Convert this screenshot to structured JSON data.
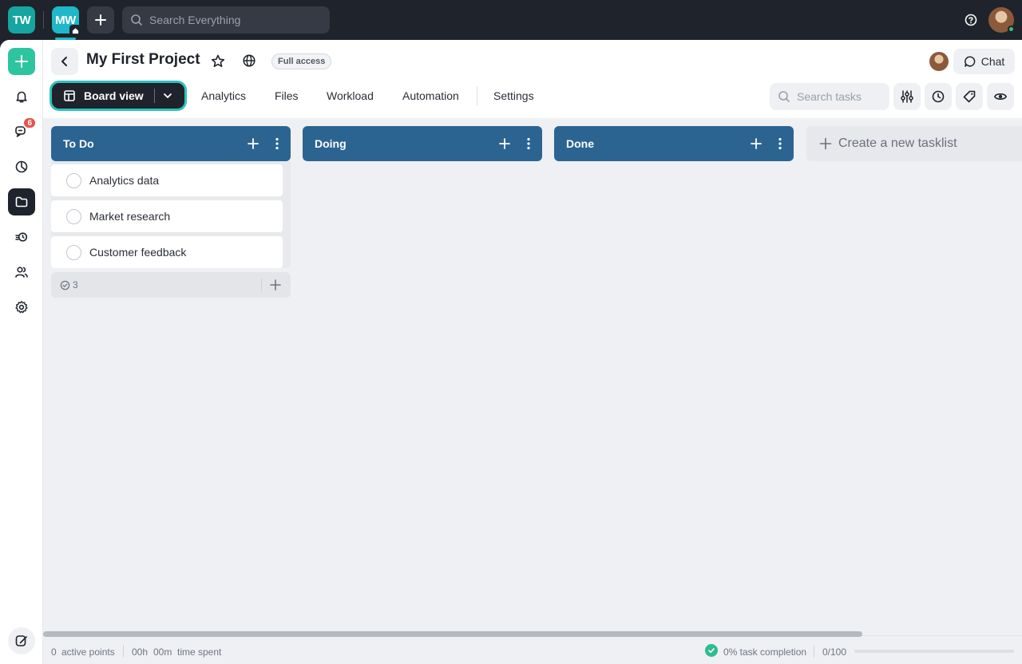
{
  "topbar": {
    "workspace_1": "TW",
    "workspace_2": "MW",
    "search_placeholder": "Search Everything"
  },
  "sidebar": {
    "messages_badge": "6"
  },
  "header": {
    "title": "My First Project",
    "access_badge": "Full access",
    "chat_label": "Chat"
  },
  "nav": {
    "view_label": "Board view",
    "tabs": [
      "Analytics",
      "Files",
      "Workload",
      "Automation",
      "Settings"
    ],
    "search_placeholder": "Search tasks"
  },
  "board": {
    "columns": [
      {
        "title": "To Do",
        "tasks": [
          "Analytics data",
          "Market research",
          "Customer feedback"
        ],
        "count": "3"
      },
      {
        "title": "Doing",
        "tasks": []
      },
      {
        "title": "Done",
        "tasks": []
      }
    ],
    "new_tasklist_label": "Create a new tasklist"
  },
  "footer": {
    "active_points": "0",
    "active_points_label": "active points",
    "time_hours": "00h",
    "time_minutes": "00m",
    "time_label": "time spent",
    "completion": "0% task completion",
    "points_ratio": "0/100",
    "progress_fraction": 0
  },
  "colors": {
    "accent": "#2ec2c0",
    "column_header": "#2c6491",
    "add_button": "#2dc5a0",
    "badge": "#e5534b"
  }
}
